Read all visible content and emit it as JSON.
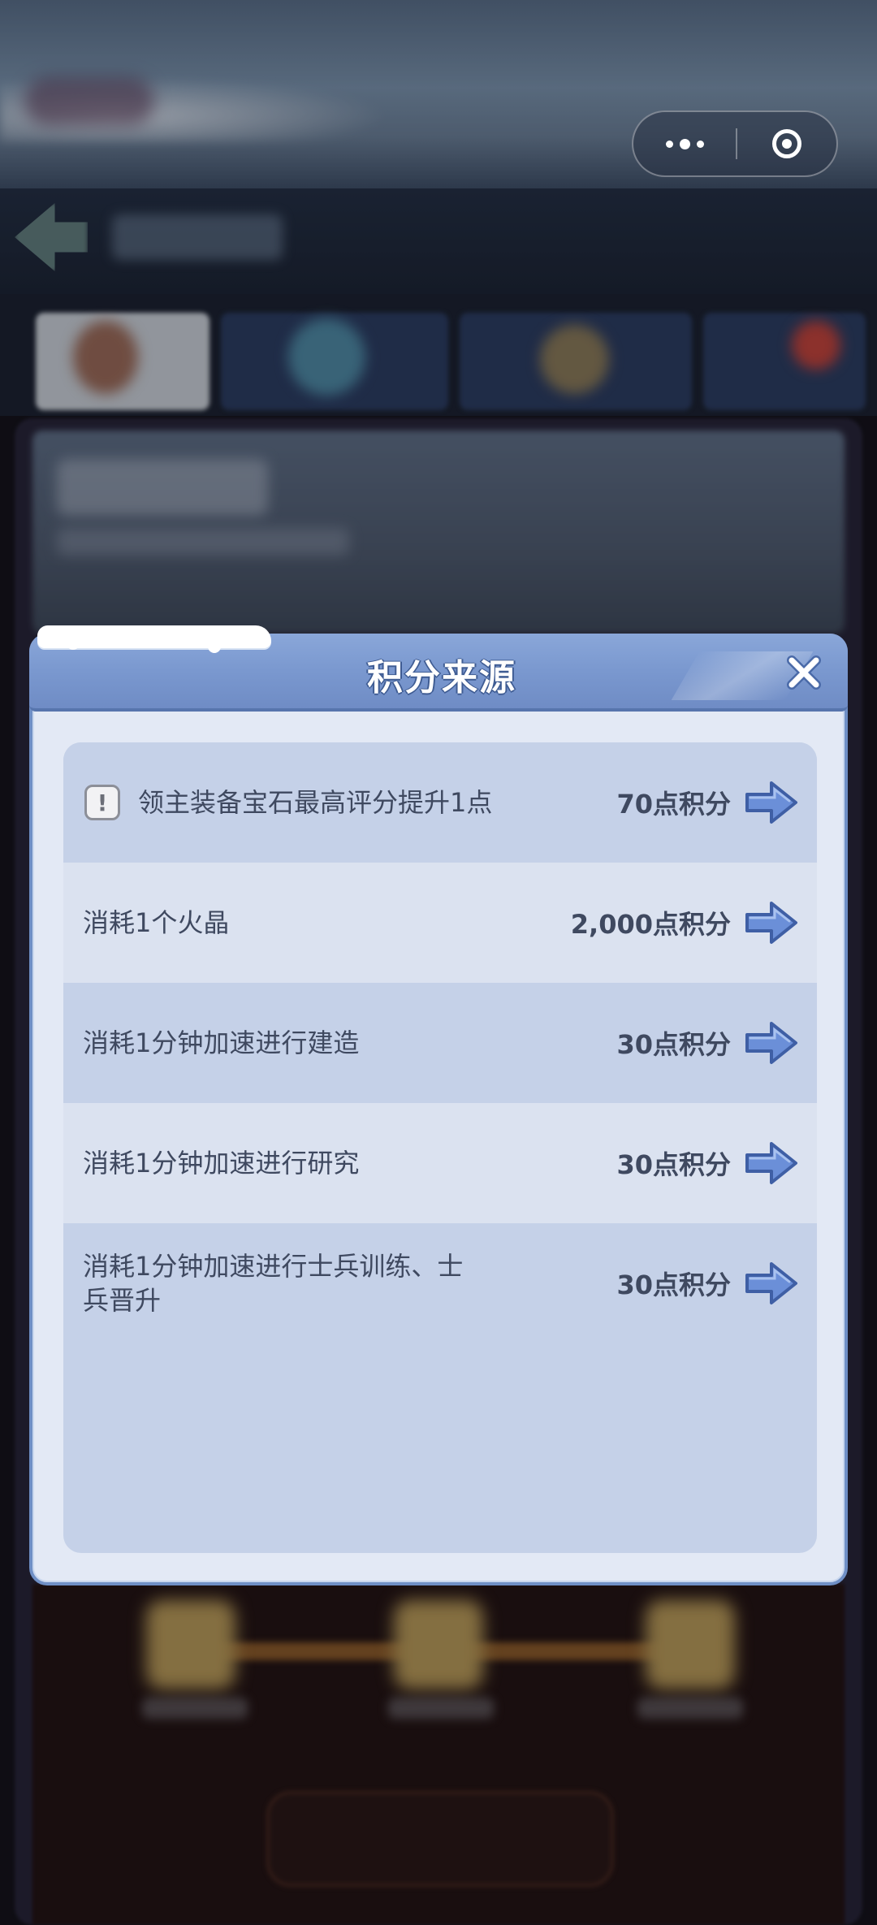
{
  "modal": {
    "title": "积分来源",
    "close_icon": "close-icon"
  },
  "sources": [
    {
      "label": "领主装备宝石最高评分提升1点",
      "points": "70点积分",
      "has_info": true,
      "info_icon": "exclamation-icon"
    },
    {
      "label": "消耗1个火晶",
      "points": "2,000点积分",
      "has_info": false
    },
    {
      "label": "消耗1分钟加速进行建造",
      "points": "30点积分",
      "has_info": false
    },
    {
      "label": "消耗1分钟加速进行研究",
      "points": "30点积分",
      "has_info": false
    },
    {
      "label": "消耗1分钟加速进行士兵训练、士兵晋升",
      "points": "30点积分",
      "has_info": false
    }
  ],
  "go_icon": "arrow-right-icon",
  "capsule": {
    "more_icon": "more-dots-icon",
    "close_icon": "mini-program-close-icon"
  },
  "colors": {
    "modal_header": "#7a98cf",
    "modal_body": "#e3e9f5",
    "row_dark": "#c5d1e8",
    "row_light": "#dbe2f0",
    "text": "#3f4960",
    "arrow": "#6b8fd8"
  }
}
